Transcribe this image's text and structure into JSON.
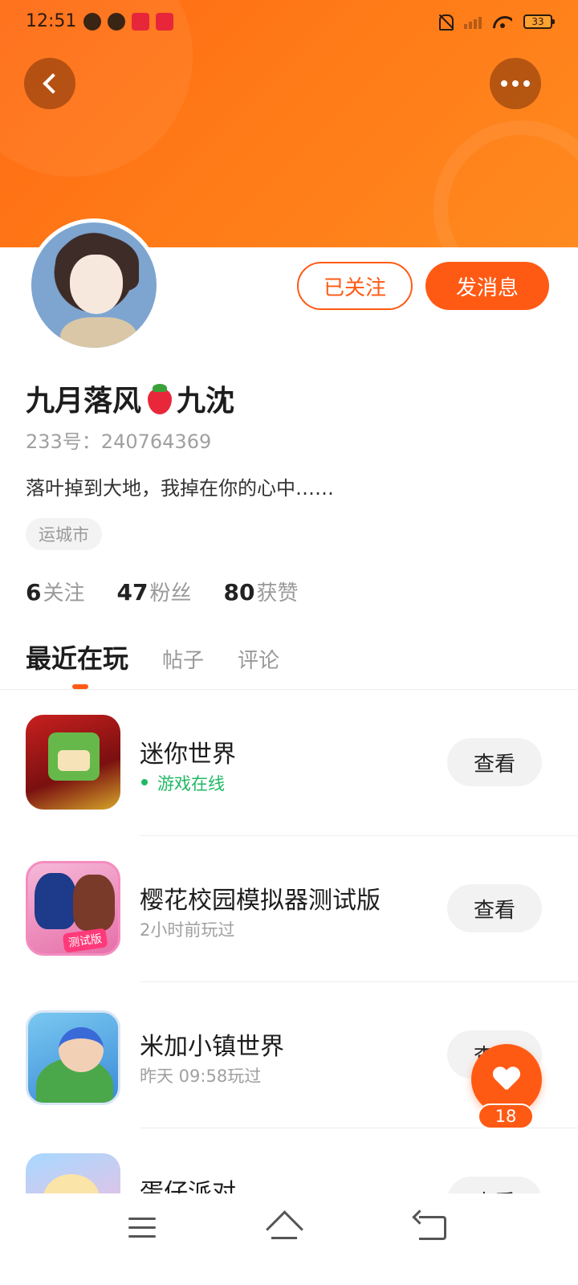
{
  "status_bar": {
    "time": "12:51",
    "battery": "33"
  },
  "header": {
    "back_icon": "chevron-left-icon",
    "more_icon": "more-dots-icon"
  },
  "profile": {
    "followed_label": "已关注",
    "message_label": "发消息",
    "name_part1": "九月落风",
    "name_emoji": "strawberry-emoji",
    "name_part2": "九沈",
    "uid": "233号：240764369",
    "bio": "落叶掉到大地，我掉在你的心中……",
    "location": "运城市",
    "stats": [
      {
        "num": "6",
        "label": "关注"
      },
      {
        "num": "47",
        "label": "粉丝"
      },
      {
        "num": "80",
        "label": "获赞"
      }
    ]
  },
  "tabs": [
    {
      "label": "最近在玩",
      "active": true
    },
    {
      "label": "帖子",
      "active": false
    },
    {
      "label": "评论",
      "active": false
    }
  ],
  "games": [
    {
      "title": "迷你世界",
      "sub": "游戏在线",
      "online": true,
      "button": "查看"
    },
    {
      "title": "樱花校园模拟器测试版",
      "sub": "2小时前玩过",
      "online": false,
      "button": "查看",
      "icon_tag": "测试版"
    },
    {
      "title": "米加小镇世界",
      "sub": "昨天 09:58玩过",
      "online": false,
      "button": "查看"
    },
    {
      "title": "蛋仔派对",
      "sub": "",
      "online": false,
      "button": "查看"
    }
  ],
  "fab": {
    "icon": "heart-icon",
    "count": "18"
  },
  "colors": {
    "accent": "#ff5a14",
    "online_green": "#20b865",
    "banner_orange": "#ff7a18"
  }
}
